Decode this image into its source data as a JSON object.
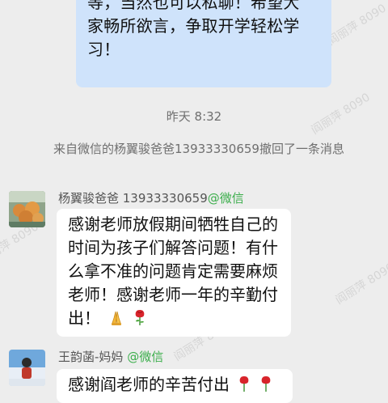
{
  "outgoing_message": {
    "lines": [
      "等，当然也可以私聊！希望大",
      "家畅所欲言，争取开学轻松学",
      "习！"
    ]
  },
  "timestamp": "昨天 8:32",
  "recall_notice": "来自微信的杨翼骏爸爸13933330659撤回了一条消息",
  "watermark_text": "阎丽萍 8090",
  "messages": [
    {
      "sender_name": "杨翼骏爸爸 13933330659",
      "sender_tag": "@微信",
      "lines": [
        "感谢老师放假期间牺牲自己的",
        "时间为孩子们解答问题！有什",
        "么拿不准的问题肯定需要麻烦",
        "老师！感谢老师一年的辛勤付",
        "出！"
      ],
      "emojis": [
        "folded-hands-icon",
        "rose-icon"
      ]
    },
    {
      "sender_name": "王韵菡-妈妈",
      "sender_tag": "@微信",
      "lines": [
        "感谢阎老师的辛苦付出"
      ],
      "emojis": [
        "rose-icon",
        "rose-icon"
      ]
    }
  ],
  "colors": {
    "background": "#ededed",
    "outgoing_bubble": "#cfe3fb",
    "incoming_bubble": "#ffffff",
    "wechat_tag": "#3cae4c"
  }
}
